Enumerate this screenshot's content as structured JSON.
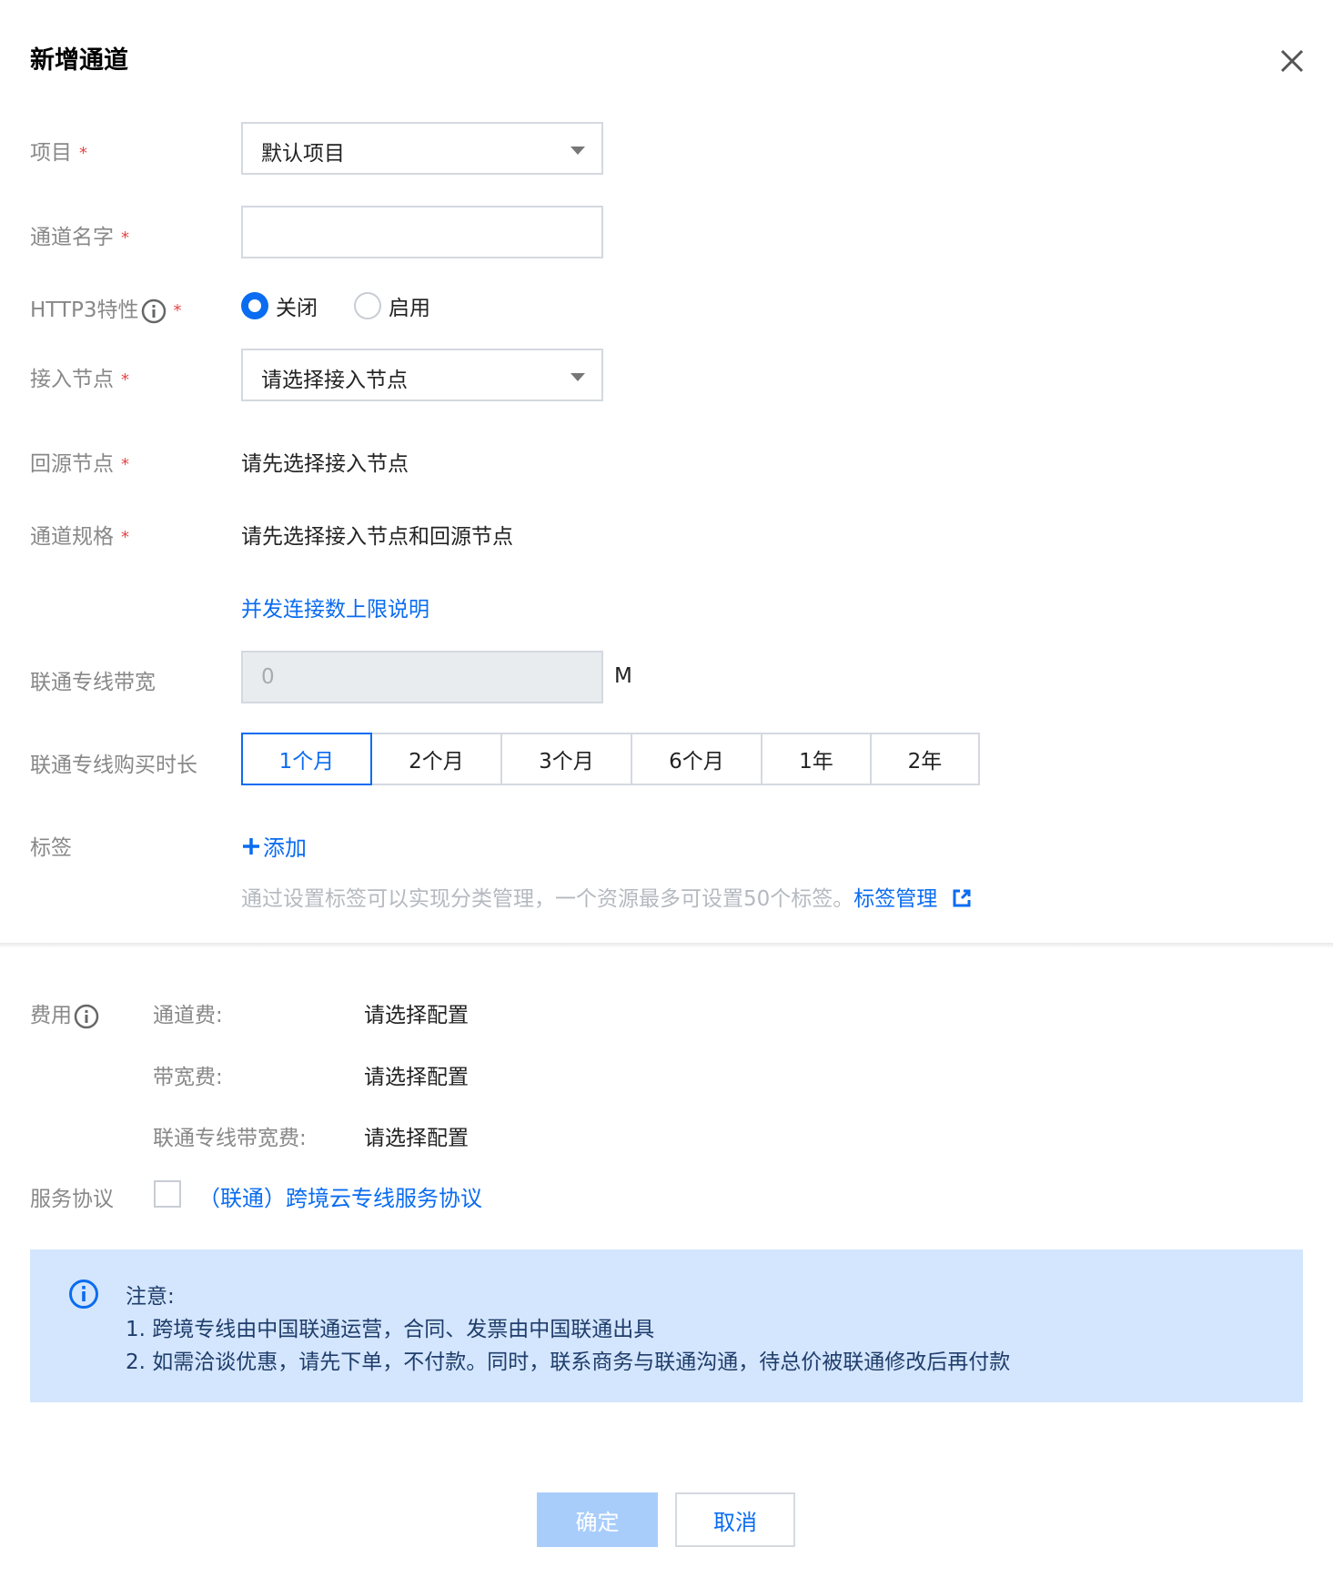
{
  "dialog": {
    "title": "新增通道"
  },
  "form": {
    "required_mark": "*",
    "project": {
      "label": "项目",
      "value": "默认项目"
    },
    "channel_name": {
      "label": "通道名字",
      "value": ""
    },
    "http3": {
      "label": "HTTP3特性",
      "options": [
        "关闭",
        "启用"
      ],
      "selected": "关闭"
    },
    "access_node": {
      "label": "接入节点",
      "value": "请选择接入节点"
    },
    "origin_node": {
      "label": "回源节点",
      "value": "请先选择接入节点"
    },
    "spec": {
      "label": "通道规格",
      "value": "请先选择接入节点和回源节点",
      "link": "并发连接数上限说明"
    },
    "bandwidth": {
      "label": "联通专线带宽",
      "value": "0",
      "unit": "M"
    },
    "duration": {
      "label": "联通专线购买时长",
      "options": [
        "1个月",
        "2个月",
        "3个月",
        "6个月",
        "1年",
        "2年"
      ],
      "selected": "1个月"
    },
    "tags": {
      "label": "标签",
      "add": "添加",
      "hint": "通过设置标签可以实现分类管理，一个资源最多可设置50个标签。",
      "manage_link": "标签管理"
    }
  },
  "fees": {
    "label": "费用",
    "items": [
      {
        "key": "通道费:",
        "value": "请选择配置"
      },
      {
        "key": "带宽费:",
        "value": "请选择配置"
      },
      {
        "key": "联通专线带宽费:",
        "value": "请选择配置"
      }
    ]
  },
  "agreement": {
    "label": "服务协议",
    "link": "（联通）跨境云专线服务协议",
    "checked": false
  },
  "notice": {
    "title": "注意:",
    "lines": [
      "1. 跨境专线由中国联通运营，合同、发票由中国联通出具",
      "2. 如需洽谈优惠，请先下单，不付款。同时，联系商务与联通沟通，待总价被联通修改后再付款"
    ]
  },
  "footer": {
    "ok": "确定",
    "cancel": "取消"
  },
  "colors": {
    "accent": "#0a6cf0",
    "required": "#e54545",
    "notice_bg": "#d4e6fd",
    "ok_disabled": "#a9cdfb"
  }
}
